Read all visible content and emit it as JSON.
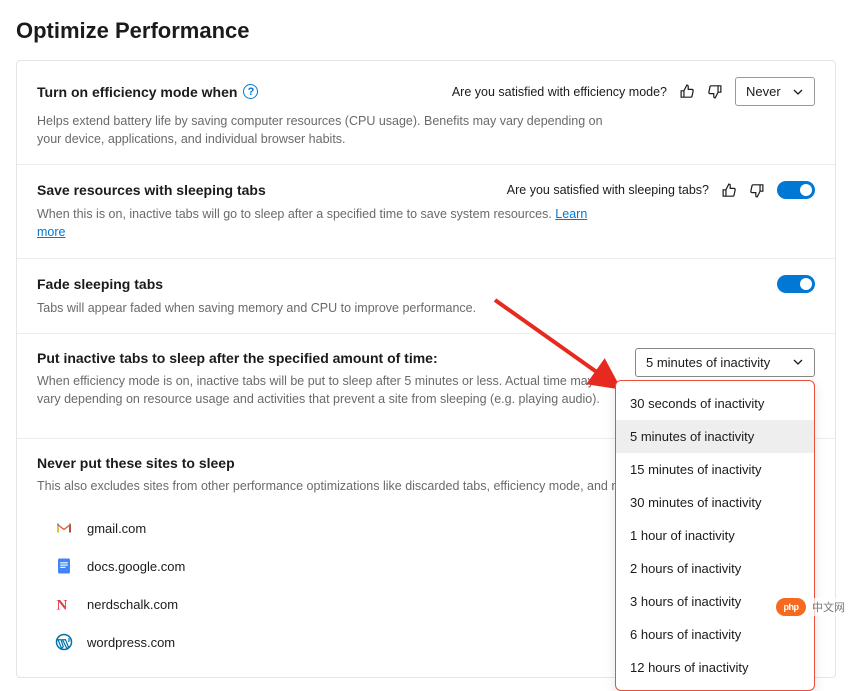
{
  "page": {
    "title": "Optimize Performance"
  },
  "efficiency": {
    "title": "Turn on efficiency mode when",
    "desc": "Helps extend battery life by saving computer resources (CPU usage). Benefits may vary depending on your device, applications, and individual browser habits.",
    "satisfied": "Are you satisfied with efficiency mode?",
    "dropdown_value": "Never"
  },
  "sleeping": {
    "title": "Save resources with sleeping tabs",
    "desc_prefix": "When this is on, inactive tabs will go to sleep after a specified time to save system resources. ",
    "learn_more": "Learn more",
    "satisfied": "Are you satisfied with sleeping tabs?"
  },
  "fade": {
    "title": "Fade sleeping tabs",
    "desc": "Tabs will appear faded when saving memory and CPU to improve performance."
  },
  "sleep_time": {
    "title": "Put inactive tabs to sleep after the specified amount of time:",
    "desc": "When efficiency mode is on, inactive tabs will be put to sleep after 5 minutes or less. Actual time may vary depending on resource usage and activities that prevent a site from sleeping (e.g. playing audio).",
    "selected": "5 minutes of inactivity",
    "options": [
      "30 seconds of inactivity",
      "5 minutes of inactivity",
      "15 minutes of inactivity",
      "30 minutes of inactivity",
      "1 hour of inactivity",
      "2 hours of inactivity",
      "3 hours of inactivity",
      "6 hours of inactivity",
      "12 hours of inactivity"
    ]
  },
  "never_sleep": {
    "title": "Never put these sites to sleep",
    "desc": "This also excludes sites from other performance optimizations like discarded tabs, efficiency mode, and more.",
    "sites": [
      {
        "icon": "gmail-icon",
        "label": "gmail.com"
      },
      {
        "icon": "gdocs-icon",
        "label": "docs.google.com"
      },
      {
        "icon": "nerdschalk-icon",
        "label": "nerdschalk.com"
      },
      {
        "icon": "wordpress-icon",
        "label": "wordpress.com"
      }
    ]
  },
  "watermark": {
    "badge": "php",
    "text": "中文网"
  }
}
